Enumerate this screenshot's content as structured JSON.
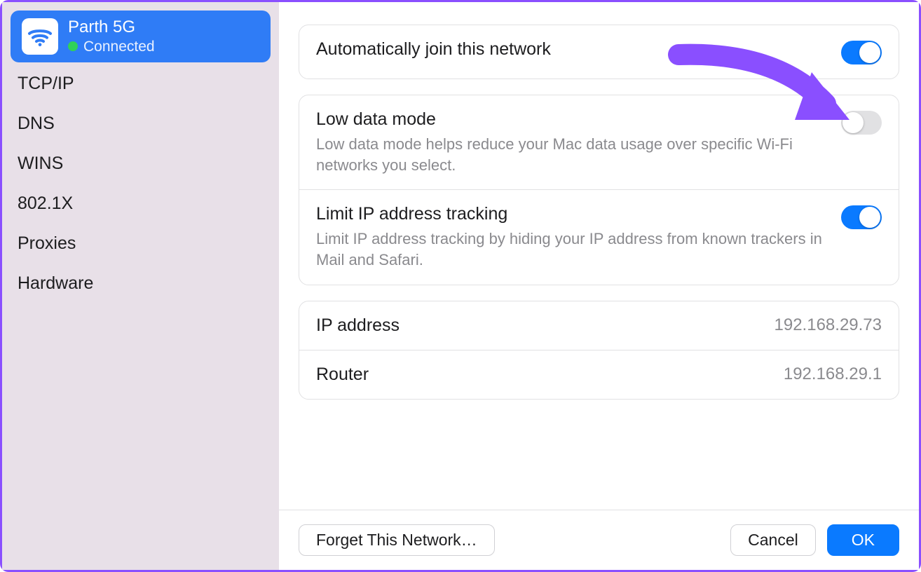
{
  "sidebar": {
    "network": {
      "name": "Parth 5G",
      "status": "Connected"
    },
    "items": [
      {
        "label": "TCP/IP"
      },
      {
        "label": "DNS"
      },
      {
        "label": "WINS"
      },
      {
        "label": "802.1X"
      },
      {
        "label": "Proxies"
      },
      {
        "label": "Hardware"
      }
    ]
  },
  "main": {
    "autoJoin": {
      "title": "Automatically join this network",
      "on": true
    },
    "lowData": {
      "title": "Low data mode",
      "desc": "Low data mode helps reduce your Mac data usage over specific Wi-Fi networks you select.",
      "on": false
    },
    "limitIp": {
      "title": "Limit IP address tracking",
      "desc": "Limit IP address tracking by hiding your IP address from known trackers in Mail and Safari.",
      "on": true
    },
    "ipAddress": {
      "label": "IP address",
      "value": "192.168.29.73"
    },
    "router": {
      "label": "Router",
      "value": "192.168.29.1"
    }
  },
  "footer": {
    "forget": "Forget This Network…",
    "cancel": "Cancel",
    "ok": "OK"
  }
}
